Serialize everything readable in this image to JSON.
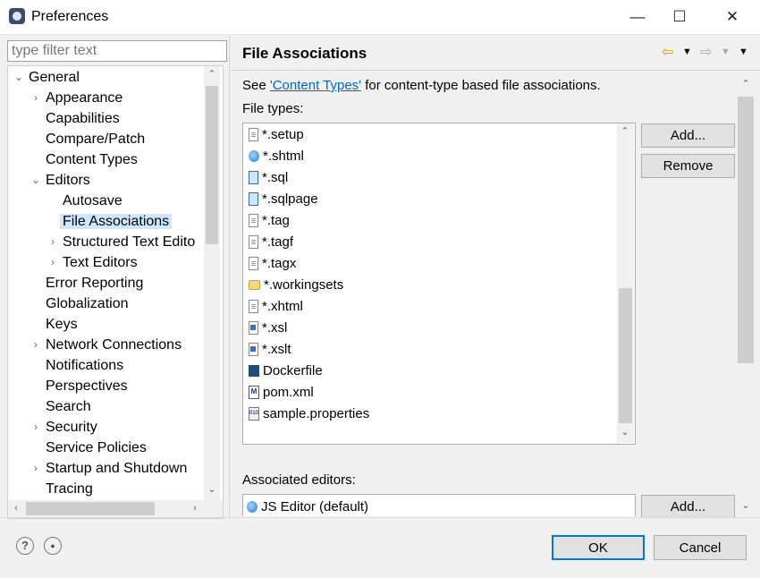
{
  "window": {
    "title": "Preferences",
    "app_icon": "eclipse-icon",
    "controls": {
      "minimize": "—",
      "maximize": "☐",
      "close": "✕"
    }
  },
  "left": {
    "filter_placeholder": "type filter text",
    "tree": [
      {
        "label": "General",
        "twisty": "expanded"
      },
      {
        "label": "Appearance",
        "twisty": "collapsed"
      },
      {
        "label": "Capabilities",
        "twisty": "none"
      },
      {
        "label": "Compare/Patch",
        "twisty": "none"
      },
      {
        "label": "Content Types",
        "twisty": "none"
      },
      {
        "label": "Editors",
        "twisty": "expanded"
      },
      {
        "label": "Autosave",
        "twisty": "none"
      },
      {
        "label": "File Associations",
        "twisty": "none",
        "selected": true
      },
      {
        "label": "Structured Text Edito",
        "twisty": "collapsed"
      },
      {
        "label": "Text Editors",
        "twisty": "collapsed"
      },
      {
        "label": "Error Reporting",
        "twisty": "none"
      },
      {
        "label": "Globalization",
        "twisty": "none"
      },
      {
        "label": "Keys",
        "twisty": "none"
      },
      {
        "label": "Network Connections",
        "twisty": "collapsed"
      },
      {
        "label": "Notifications",
        "twisty": "none"
      },
      {
        "label": "Perspectives",
        "twisty": "none"
      },
      {
        "label": "Search",
        "twisty": "none"
      },
      {
        "label": "Security",
        "twisty": "collapsed"
      },
      {
        "label": "Service Policies",
        "twisty": "none"
      },
      {
        "label": "Startup and Shutdown",
        "twisty": "collapsed"
      },
      {
        "label": "Tracing",
        "twisty": "none"
      }
    ]
  },
  "right": {
    "title": "File Associations",
    "desc_prefix": "See ",
    "desc_link": "'Content Types'",
    "desc_suffix": " for content-type based file associations.",
    "file_types_label": "File types:",
    "file_types": [
      {
        "name": "*.setup",
        "icon": "setup-file-icon"
      },
      {
        "name": "*.shtml",
        "icon": "globe-icon"
      },
      {
        "name": "*.sql",
        "icon": "sql-file-icon"
      },
      {
        "name": "*.sqlpage",
        "icon": "sql-file-icon"
      },
      {
        "name": "*.tag",
        "icon": "text-file-icon"
      },
      {
        "name": "*.tagf",
        "icon": "text-file-icon"
      },
      {
        "name": "*.tagx",
        "icon": "text-file-icon"
      },
      {
        "name": "*.workingsets",
        "icon": "folder-icon"
      },
      {
        "name": "*.xhtml",
        "icon": "html-file-icon"
      },
      {
        "name": "*.xsl",
        "icon": "xsl-file-icon"
      },
      {
        "name": "*.xslt",
        "icon": "xsl-file-icon"
      },
      {
        "name": "Dockerfile",
        "icon": "docker-icon"
      },
      {
        "name": "pom.xml",
        "icon": "maven-icon"
      },
      {
        "name": "sample.properties",
        "icon": "properties-file-icon"
      }
    ],
    "add_label": "Add...",
    "remove_label": "Remove",
    "assoc_label": "Associated editors:",
    "assoc_items": [
      {
        "name": "JS Editor (default)",
        "icon": "js-editor-icon"
      }
    ],
    "assoc_add_label": "Add..."
  },
  "footer": {
    "help_icon": "?",
    "ok_label": "OK",
    "cancel_label": "Cancel"
  }
}
